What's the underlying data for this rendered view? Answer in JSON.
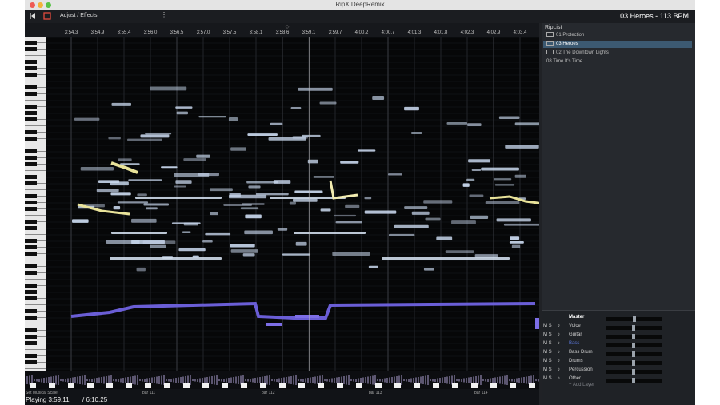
{
  "window": {
    "title": "RipX DeepRemix"
  },
  "toolbar": {
    "menu_label": "Adjust / Effects",
    "song_label": "03 Heroes - 113 BPM"
  },
  "ruler": {
    "ticks": [
      "3:54.3",
      "3:54.9",
      "3:55.4",
      "3:56.0",
      "3:56.5",
      "3:57.0",
      "3:57.5",
      "3:58.1",
      "3:58.6",
      "3:59.1",
      "3:59.7",
      "4:00.2",
      "4:00.7",
      "4:01.3",
      "4:01.8",
      "4:02.3",
      "4:02.9",
      "4:03.4"
    ]
  },
  "riplist": {
    "title": "RipList",
    "items": [
      {
        "label": "01 Protection",
        "selected": false,
        "folder": true
      },
      {
        "label": "03 Heroes",
        "selected": true,
        "folder": true
      },
      {
        "label": "02 The Downtown Lights",
        "selected": false,
        "folder": true
      },
      {
        "label": "08 Time It's Time",
        "selected": false,
        "folder": false
      }
    ]
  },
  "mixer": {
    "master_label": "Master",
    "rows": [
      {
        "label": "Voice",
        "ms": "M S",
        "level": 0.49,
        "accent": false
      },
      {
        "label": "Guitar",
        "ms": "M S",
        "level": 0.49,
        "accent": false
      },
      {
        "label": "Bass",
        "ms": "M S",
        "level": 0.49,
        "accent": true
      },
      {
        "label": "Bass Drum",
        "ms": "M S",
        "level": 0.49,
        "accent": false
      },
      {
        "label": "Drums",
        "ms": "M S",
        "level": 0.49,
        "accent": false
      },
      {
        "label": "Percussion",
        "ms": "M S",
        "level": 0.49,
        "accent": false
      },
      {
        "label": "Other",
        "ms": "M S",
        "level": 0.49,
        "accent": false
      }
    ],
    "add_layer": "+ Add Layer"
  },
  "status": {
    "mode_label": "Set Musical Scale",
    "playing": "Playing 3:59.11",
    "duration": "/ 6:10.25",
    "bars": [
      "bar 111",
      "bar 112",
      "bar 113",
      "bar 114"
    ]
  },
  "colors": {
    "accent": "#3c5971",
    "note": "#c9d8ee",
    "note_yellow": "#e9e39a",
    "note_bass": "#6a5ed6",
    "bass_label": "#5a76d6"
  }
}
